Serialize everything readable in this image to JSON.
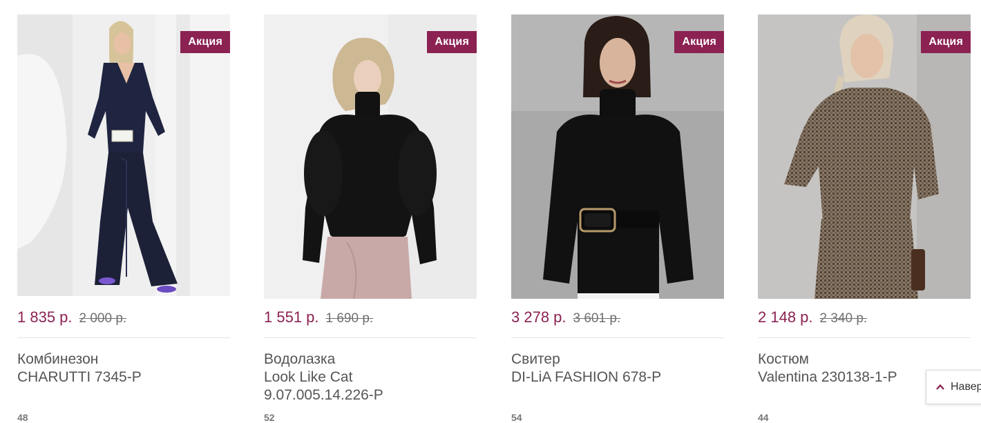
{
  "products": [
    {
      "badge": "Акция",
      "price_new": "1 835 р.",
      "price_old": "2 000 р.",
      "title_line1": "Комбинезон",
      "title_line2": "CHARUTTI 7345-P",
      "title_line3": "",
      "size": "48",
      "photo_icon": "jumpsuit-photo"
    },
    {
      "badge": "Акция",
      "price_new": "1 551 р.",
      "price_old": "1 690 р.",
      "title_line1": "Водолазка",
      "title_line2": "Look Like Cat",
      "title_line3": "9.07.005.14.226-P",
      "size": "52",
      "photo_icon": "turtleneck-photo"
    },
    {
      "badge": "Акция",
      "price_new": "3 278 р.",
      "price_old": "3 601 р.",
      "title_line1": "Свитер",
      "title_line2": "DI-LiA FASHION 678-P",
      "title_line3": "",
      "size": "54",
      "photo_icon": "sweater-photo"
    },
    {
      "badge": "Акция",
      "price_new": "2 148 р.",
      "price_old": "2 340 р.",
      "title_line1": "Костюм",
      "title_line2": "Valentina 230138-1-P",
      "title_line3": "",
      "size": "44",
      "photo_icon": "suit-photo"
    }
  ],
  "scroll_top": {
    "label": "Навер",
    "icon": "chevron-up-icon"
  },
  "colors": {
    "accent": "#8b2252",
    "text": "#555555",
    "divider": "#e3e3e3"
  }
}
